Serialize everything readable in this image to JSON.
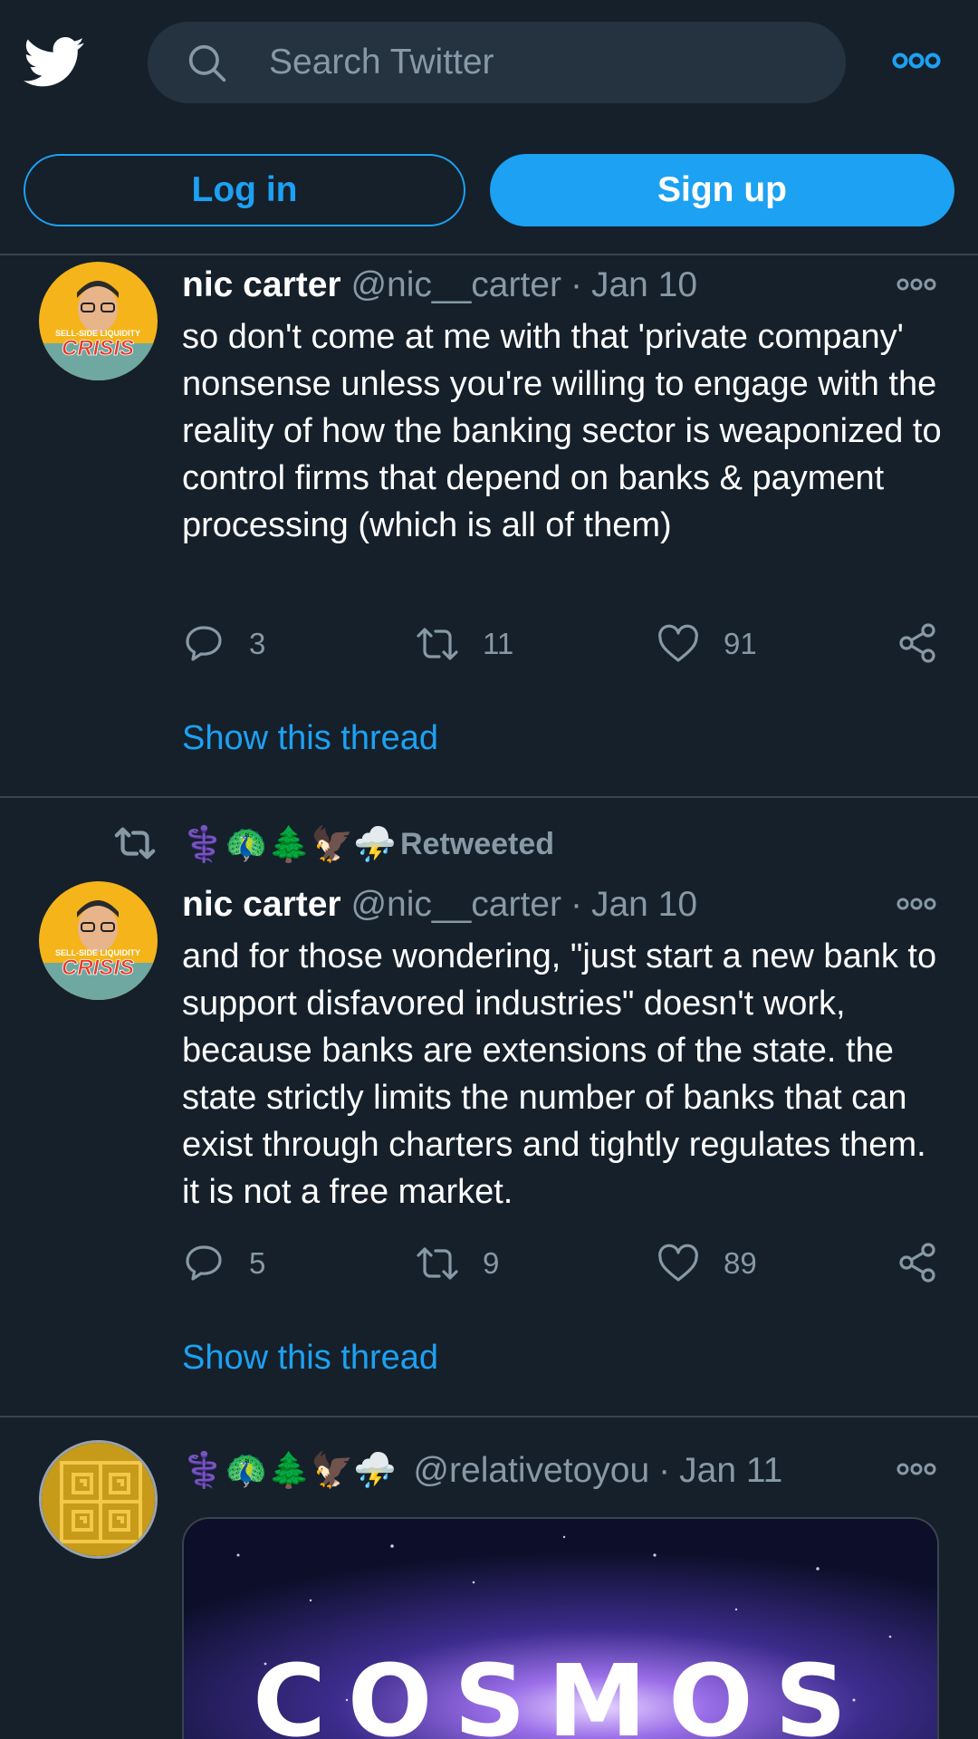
{
  "search": {
    "placeholder": "Search Twitter"
  },
  "auth": {
    "login_label": "Log in",
    "signup_label": "Sign up"
  },
  "tweets": [
    {
      "name": "nic carter",
      "handle": "@nic__carter",
      "separator": "·",
      "date": "Jan 10",
      "avatar_text_top": "SELL-SIDE LIQUIDITY",
      "avatar_text_main": "CRISIS",
      "text": "so don't come at me with that 'private company' nonsense unless you're willing to engage with the reality of how the banking sector is weaponized to control firms that depend on banks & payment processing (which is all of them)",
      "replies": "3",
      "retweets": "11",
      "likes": "91",
      "thread_link": "Show this thread"
    },
    {
      "retweeted_by_emoji": "⚕️🦚🌲🦅⛈️",
      "retweeted_label": "Retweeted",
      "name": "nic carter",
      "handle": "@nic__carter",
      "separator": "·",
      "date": "Jan 10",
      "avatar_text_top": "SELL-SIDE LIQUIDITY",
      "avatar_text_main": "CRISIS",
      "text": "and for those wondering, \"just start a new bank to support disfavored industries\" doesn't work, because banks are extensions of the state. the state strictly limits the number of banks that can exist through charters and tightly regulates them. it is not a free market.",
      "replies": "5",
      "retweets": "9",
      "likes": "89",
      "thread_link": "Show this thread"
    },
    {
      "name_emoji": "⚕️🦚🌲🦅⛈️",
      "handle": "@relativetoyou",
      "separator": "·",
      "date": "Jan 11",
      "media_title": "COSMOS"
    }
  ],
  "colors": {
    "background": "#15202b",
    "accent": "#1da1f2",
    "muted": "#8899a6",
    "divider": "#38444d"
  }
}
